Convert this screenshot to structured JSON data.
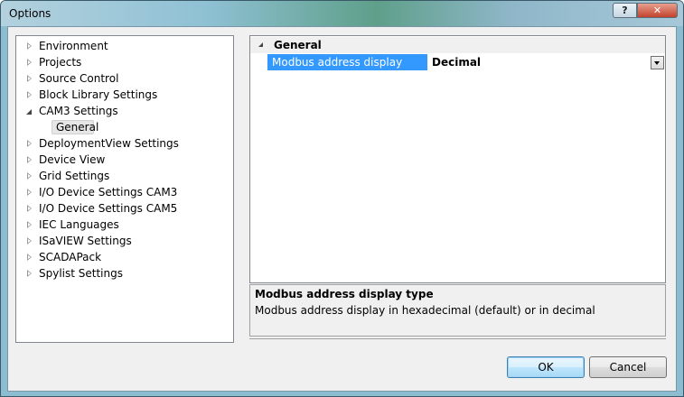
{
  "window": {
    "title": "Options",
    "help_label": "?",
    "close_label": "✕"
  },
  "tree": {
    "items": [
      {
        "label": "Environment",
        "state": "collapsed"
      },
      {
        "label": "Projects",
        "state": "collapsed"
      },
      {
        "label": "Source Control",
        "state": "collapsed"
      },
      {
        "label": "Block Library Settings",
        "state": "collapsed"
      },
      {
        "label": "CAM3 Settings",
        "state": "expanded"
      },
      {
        "label": "General",
        "state": "child-selected"
      },
      {
        "label": "DeploymentView Settings",
        "state": "collapsed"
      },
      {
        "label": "Device View",
        "state": "collapsed"
      },
      {
        "label": "Grid Settings",
        "state": "collapsed"
      },
      {
        "label": "I/O Device Settings CAM3",
        "state": "collapsed"
      },
      {
        "label": "I/O Device Settings CAM5",
        "state": "collapsed"
      },
      {
        "label": "IEC Languages",
        "state": "collapsed"
      },
      {
        "label": "ISaVIEW Settings",
        "state": "collapsed"
      },
      {
        "label": "SCADAPack",
        "state": "collapsed"
      },
      {
        "label": "Spylist Settings",
        "state": "collapsed"
      }
    ]
  },
  "property_grid": {
    "category": "General",
    "properties": [
      {
        "name": "Modbus address display type",
        "value": "Decimal"
      }
    ]
  },
  "description": {
    "title": "Modbus address display type",
    "text": "Modbus address display in hexadecimal (default) or in decimal"
  },
  "buttons": {
    "ok": "OK",
    "cancel": "Cancel"
  },
  "colors": {
    "selection": "#3399ff",
    "ok_border": "#3c7fb1"
  }
}
